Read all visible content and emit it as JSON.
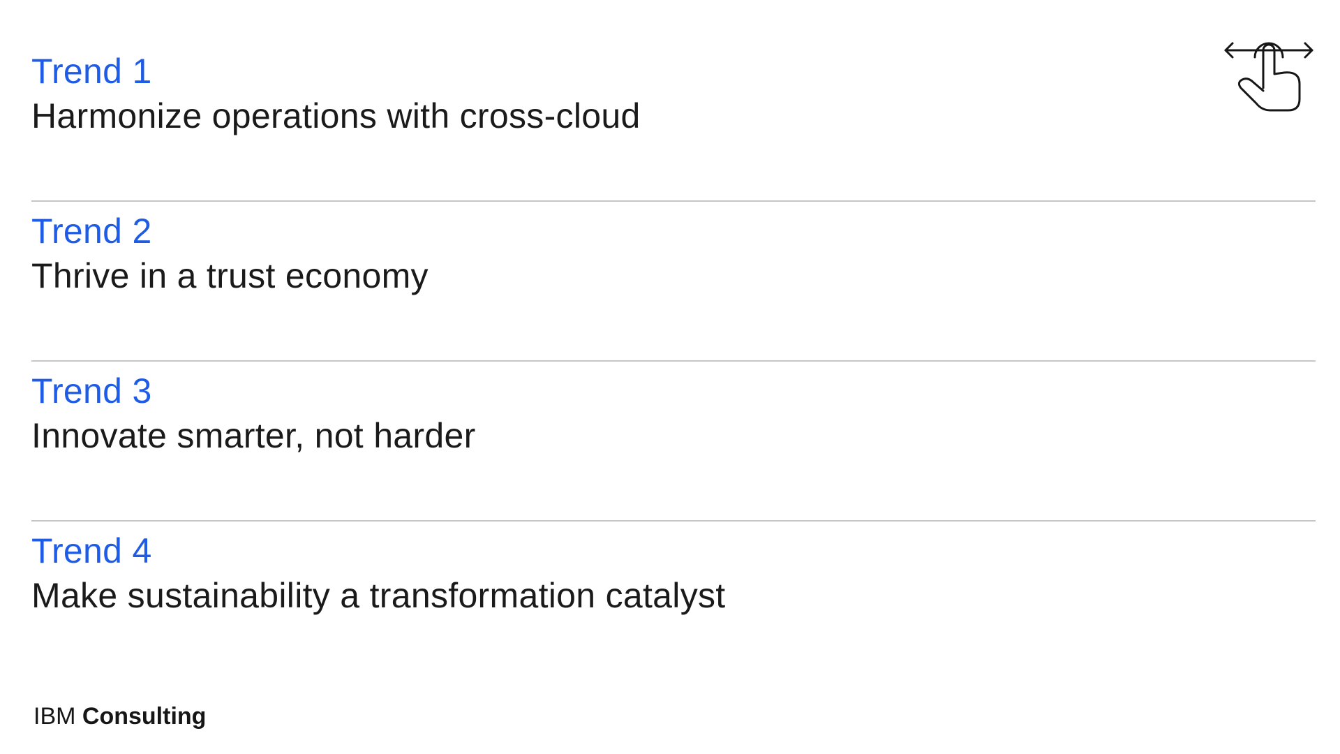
{
  "trends": [
    {
      "label": "Trend 1",
      "title": "Harmonize operations with cross-cloud"
    },
    {
      "label": "Trend 2",
      "title": "Thrive in a trust economy"
    },
    {
      "label": "Trend 3",
      "title": "Innovate smarter, not harder"
    },
    {
      "label": "Trend 4",
      "title": "Make sustainability a transformation catalyst"
    }
  ],
  "icons": {
    "swipe": "swipe-gesture-icon"
  },
  "brand": {
    "ibm": "IBM",
    "consulting": "Consulting"
  },
  "colors": {
    "accent": "#1f5ce6",
    "text": "#1a1a1a",
    "divider": "#c6c6c6",
    "background": "#ffffff"
  }
}
